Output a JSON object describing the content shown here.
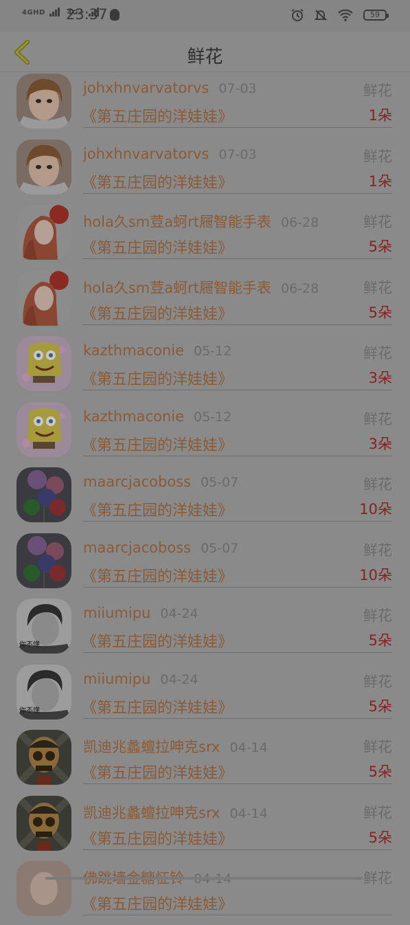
{
  "status_bar": {
    "network_1": "4GHD",
    "network_2": "4G+",
    "time": "23:37",
    "battery": "59"
  },
  "nav": {
    "title": "鲜花",
    "back_icon": "chevron-left-icon"
  },
  "records": [
    {
      "user": "johxhnvarvatorvs",
      "date": "07-03",
      "type": "鲜花",
      "book": "《第五庄园的洋娃娃》",
      "amount": "1朵",
      "avatar": "girl-portrait"
    },
    {
      "user": "johxhnvarvatorvs",
      "date": "07-03",
      "type": "鲜花",
      "book": "《第五庄园的洋娃娃》",
      "amount": "1朵",
      "avatar": "girl-portrait"
    },
    {
      "user": "hola久sm荳a蚵rt屜智能手表",
      "date": "06-28",
      "type": "鲜花",
      "book": "《第五庄园的洋娃娃》",
      "amount": "5朵",
      "avatar": "red-hair-girl"
    },
    {
      "user": "hola久sm荳a蚵rt屜智能手表",
      "date": "06-28",
      "type": "鲜花",
      "book": "《第五庄园的洋娃娃》",
      "amount": "5朵",
      "avatar": "red-hair-girl"
    },
    {
      "user": "kazthmaconie",
      "date": "05-12",
      "type": "鲜花",
      "book": "《第五庄园的洋娃娃》",
      "amount": "3朵",
      "avatar": "spongebob"
    },
    {
      "user": "kazthmaconie",
      "date": "05-12",
      "type": "鲜花",
      "book": "《第五庄园的洋娃娃》",
      "amount": "3朵",
      "avatar": "spongebob"
    },
    {
      "user": "maarcjacoboss",
      "date": "05-07",
      "type": "鲜花",
      "book": "《第五庄园的洋娃娃》",
      "amount": "10朵",
      "avatar": "balloons"
    },
    {
      "user": "maarcjacoboss",
      "date": "05-07",
      "type": "鲜花",
      "book": "《第五庄园的洋娃娃》",
      "amount": "10朵",
      "avatar": "balloons"
    },
    {
      "user": "miiumipu",
      "date": "04-24",
      "type": "鲜花",
      "book": "《第五庄园的洋娃娃》",
      "amount": "5朵",
      "avatar": "boy-bw",
      "avatar_caption": "你不懂"
    },
    {
      "user": "miiumipu",
      "date": "04-24",
      "type": "鲜花",
      "book": "《第五庄园的洋娃娃》",
      "amount": "5朵",
      "avatar": "boy-bw",
      "avatar_caption": "你不懂"
    },
    {
      "user": "凯迪兆蠡蟺拉呻克srx",
      "date": "04-14",
      "type": "鲜花",
      "book": "《第五庄园的洋娃娃》",
      "amount": "5朵",
      "avatar": "skull"
    },
    {
      "user": "凯迪兆蠡蟺拉呻克srx",
      "date": "04-14",
      "type": "鲜花",
      "book": "《第五庄园的洋娃娃》",
      "amount": "5朵",
      "avatar": "skull"
    },
    {
      "user": "佛跳墙金糖怔铃",
      "date": "04-14",
      "type": "鲜花",
      "book": "《第五庄园的洋娃娃》",
      "amount": "",
      "avatar": "girl-partial"
    }
  ],
  "colors": {
    "overlay_bg": "#8a8a8a",
    "username": "#8a5a36",
    "amount": "#8a2020",
    "meta": "#6a6a6a"
  }
}
